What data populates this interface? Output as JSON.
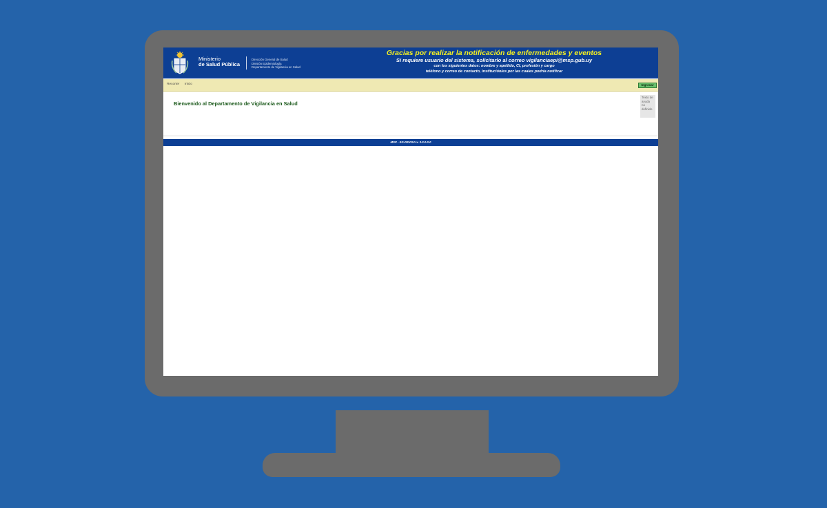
{
  "logo": {
    "ministry_line1": "Ministerio",
    "ministry_line2": "de Salud Pública",
    "dept_line1": "Dirección General de Salud",
    "dept_line2": "División Epidemiología",
    "dept_line3": "Departamento de Vigilancia en Salud"
  },
  "notice": {
    "title": "Gracias por realizar la notificación de enfermedades y eventos",
    "line1": "Si requiere usuario del sistema, solicitarlo al correo vigilanciaepi@msp.gub.uy",
    "line2": "con los siguientes datos: nombre y apellido, CI, profesión y cargo",
    "line3": "teléfono y correo de contacto, institución/es por las cuales podría notificar"
  },
  "nav": {
    "items": [
      "Recorter",
      "Inicio"
    ],
    "login_label": "Ingresar"
  },
  "main": {
    "welcome": "Bienvenido al Departamento de Vigilancia en Salud",
    "help_text": "Texto de ayuda no definido"
  },
  "footer": {
    "version": "MSP - SG-DEVISA v. 0.3.0.0.0"
  },
  "colors": {
    "background": "#2463aa",
    "header": "#0d3f94",
    "title_accent": "#f4f023",
    "navbar": "#efe9b3",
    "login_button": "#6ac06e",
    "welcome_text": "#1c5a1c"
  }
}
